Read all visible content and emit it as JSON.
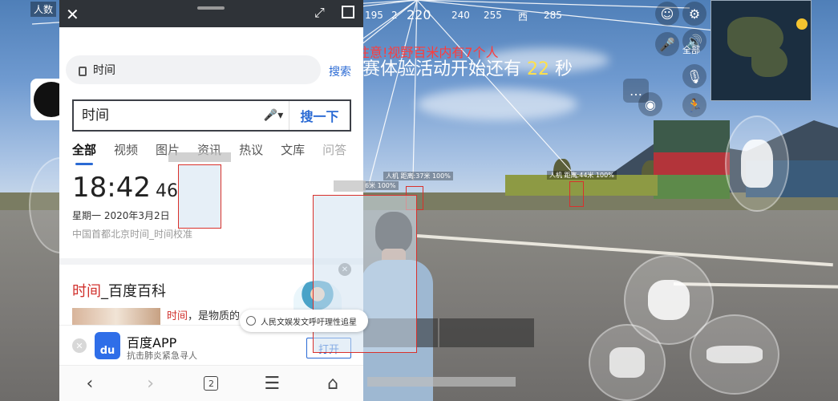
{
  "game": {
    "players_label": "人数",
    "compass_ticks": [
      "195",
      "2",
      "220",
      "240",
      "255",
      "西",
      "285"
    ],
    "warning_text": "注意!视野百米内有7个人",
    "countdown_prefix": "赛体验活动开始还有 ",
    "countdown_value": "22",
    "countdown_suffix": " 秒",
    "enemy_tags": [
      "人机 距离:37米 100%",
      "6米 100%",
      "人机 距离:44米 100%"
    ],
    "all_label": "全部",
    "colors": {
      "warning": "#ff3b3b",
      "countdown_number": "#ffe14a",
      "box": "#d9312c"
    }
  },
  "browser": {
    "url_text": "时间",
    "search_link": "搜索",
    "query": "时间",
    "search_button": "搜一下",
    "tabs": [
      {
        "label": "全部",
        "active": true
      },
      {
        "label": "视频",
        "active": false
      },
      {
        "label": "图片",
        "active": false
      },
      {
        "label": "资讯",
        "active": false
      },
      {
        "label": "热议",
        "active": false
      },
      {
        "label": "文库",
        "active": false
      },
      {
        "label": "问答",
        "active": false
      }
    ],
    "clock": {
      "hm": "18:42",
      "sec": "46"
    },
    "date": "星期一  2020年3月2日",
    "source": "中国首都北京时间_时间校准",
    "result": {
      "title_hl": "时间",
      "title_rest": "_百度百科",
      "snippet_hl": "时间",
      "snippet_rest": "，是物质的"
    },
    "trending": "人民文娱发文呼吁理性追星",
    "app_banner": {
      "name": "百度APP",
      "sub": "抗击肺炎紧急寻人",
      "open": "打开",
      "logo": "du"
    },
    "nav": {
      "tab_count": "2"
    },
    "colors": {
      "accent": "#2a6ad4",
      "highlight": "#d0302c",
      "topbar": "#2f3338"
    }
  }
}
